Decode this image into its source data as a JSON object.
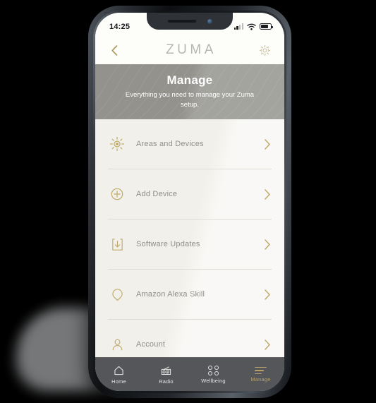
{
  "status_bar": {
    "time": "14:25",
    "signal_icon": "cellular-signal-icon",
    "wifi_icon": "wifi-icon",
    "battery_icon": "battery-icon"
  },
  "app_header": {
    "back_icon": "chevron-left-icon",
    "logo": "ZUMA",
    "settings_icon": "gear-icon"
  },
  "banner": {
    "title": "Manage",
    "subtitle": "Everything you need to manage your Zuma setup."
  },
  "menu": {
    "items": [
      {
        "label": "Areas and Devices",
        "icon": "brightness-sun-icon",
        "chevron": "chevron-right-icon"
      },
      {
        "label": "Add Device",
        "icon": "plus-circle-icon",
        "chevron": "chevron-right-icon"
      },
      {
        "label": "Software Updates",
        "icon": "download-icon",
        "chevron": "chevron-right-icon"
      },
      {
        "label": "Amazon Alexa Skill",
        "icon": "speech-bubble-icon",
        "chevron": "chevron-right-icon"
      },
      {
        "label": "Account",
        "icon": "person-icon",
        "chevron": "chevron-right-icon"
      }
    ]
  },
  "tabbar": {
    "tabs": [
      {
        "label": "Home",
        "icon": "home-icon",
        "active": false
      },
      {
        "label": "Radio",
        "icon": "radio-icon",
        "active": false
      },
      {
        "label": "Wellbeing",
        "icon": "wellbeing-dots-icon",
        "active": false
      },
      {
        "label": "Manage",
        "icon": "menu-lines-icon",
        "active": true
      }
    ]
  },
  "colors": {
    "accent_gold": "#b5a06a",
    "banner_gray": "#93928d",
    "list_bg": "#f1f0ea",
    "tabbar_bg": "#55565a",
    "label_gray": "#8f8e8a"
  }
}
